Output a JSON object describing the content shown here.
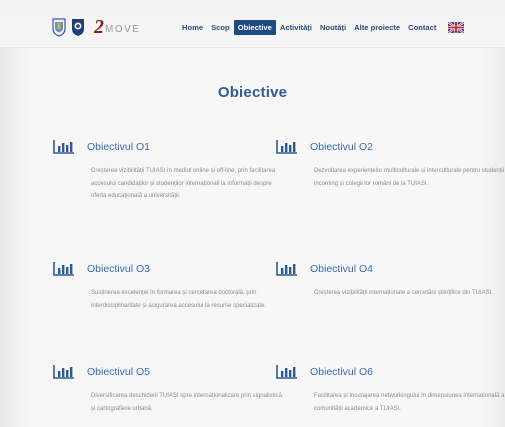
{
  "nav": {
    "items": [
      {
        "label": "Home",
        "active": false
      },
      {
        "label": "Scop",
        "active": false
      },
      {
        "label": "Obiective",
        "active": true
      },
      {
        "label": "Activități",
        "active": false
      },
      {
        "label": "Noutăți",
        "active": false
      },
      {
        "label": "Alte proiecte",
        "active": false
      },
      {
        "label": "Contact",
        "active": false
      }
    ]
  },
  "logo": {
    "number": "2",
    "word": "MOVE"
  },
  "page_title": "Obiective",
  "objectives": [
    {
      "title": "Obiectivul O1",
      "text": "Creșterea vizibilității TUIASI în mediul online și off-line, prin facilitarea accesului candidaților și studenților internaționali la informații despre oferta educațională a universității."
    },
    {
      "title": "Obiectivul O2",
      "text": "Dezvoltarea experiențelor multiculturale și interculturale pentru studenții incoming și colegii lor români de la TUIASI."
    },
    {
      "title": "Obiectivul O3",
      "text": "Susținerea excelenței în formarea și cercetarea doctorală, prin interdisciplinaritate și asigurarea accesului la resurse specializate."
    },
    {
      "title": "Obiectivul O4",
      "text": "Creșterea vizibilității internaționale a cercetării științifice din TUIASI."
    },
    {
      "title": "Obiectivul O5",
      "text": "Diversificarea deschiderii TUIASI spre internaționalizare prin signalistică și cartografiere urbană."
    },
    {
      "title": "Obiectivul O6",
      "text": "Facilitarea și încurajarea networkingului în dimensiunea internațională a comunității academice a TUIASI."
    }
  ],
  "colors": {
    "accent": "#1f4a86",
    "title": "#2e5a93",
    "objective_title": "#3a6aa8"
  }
}
